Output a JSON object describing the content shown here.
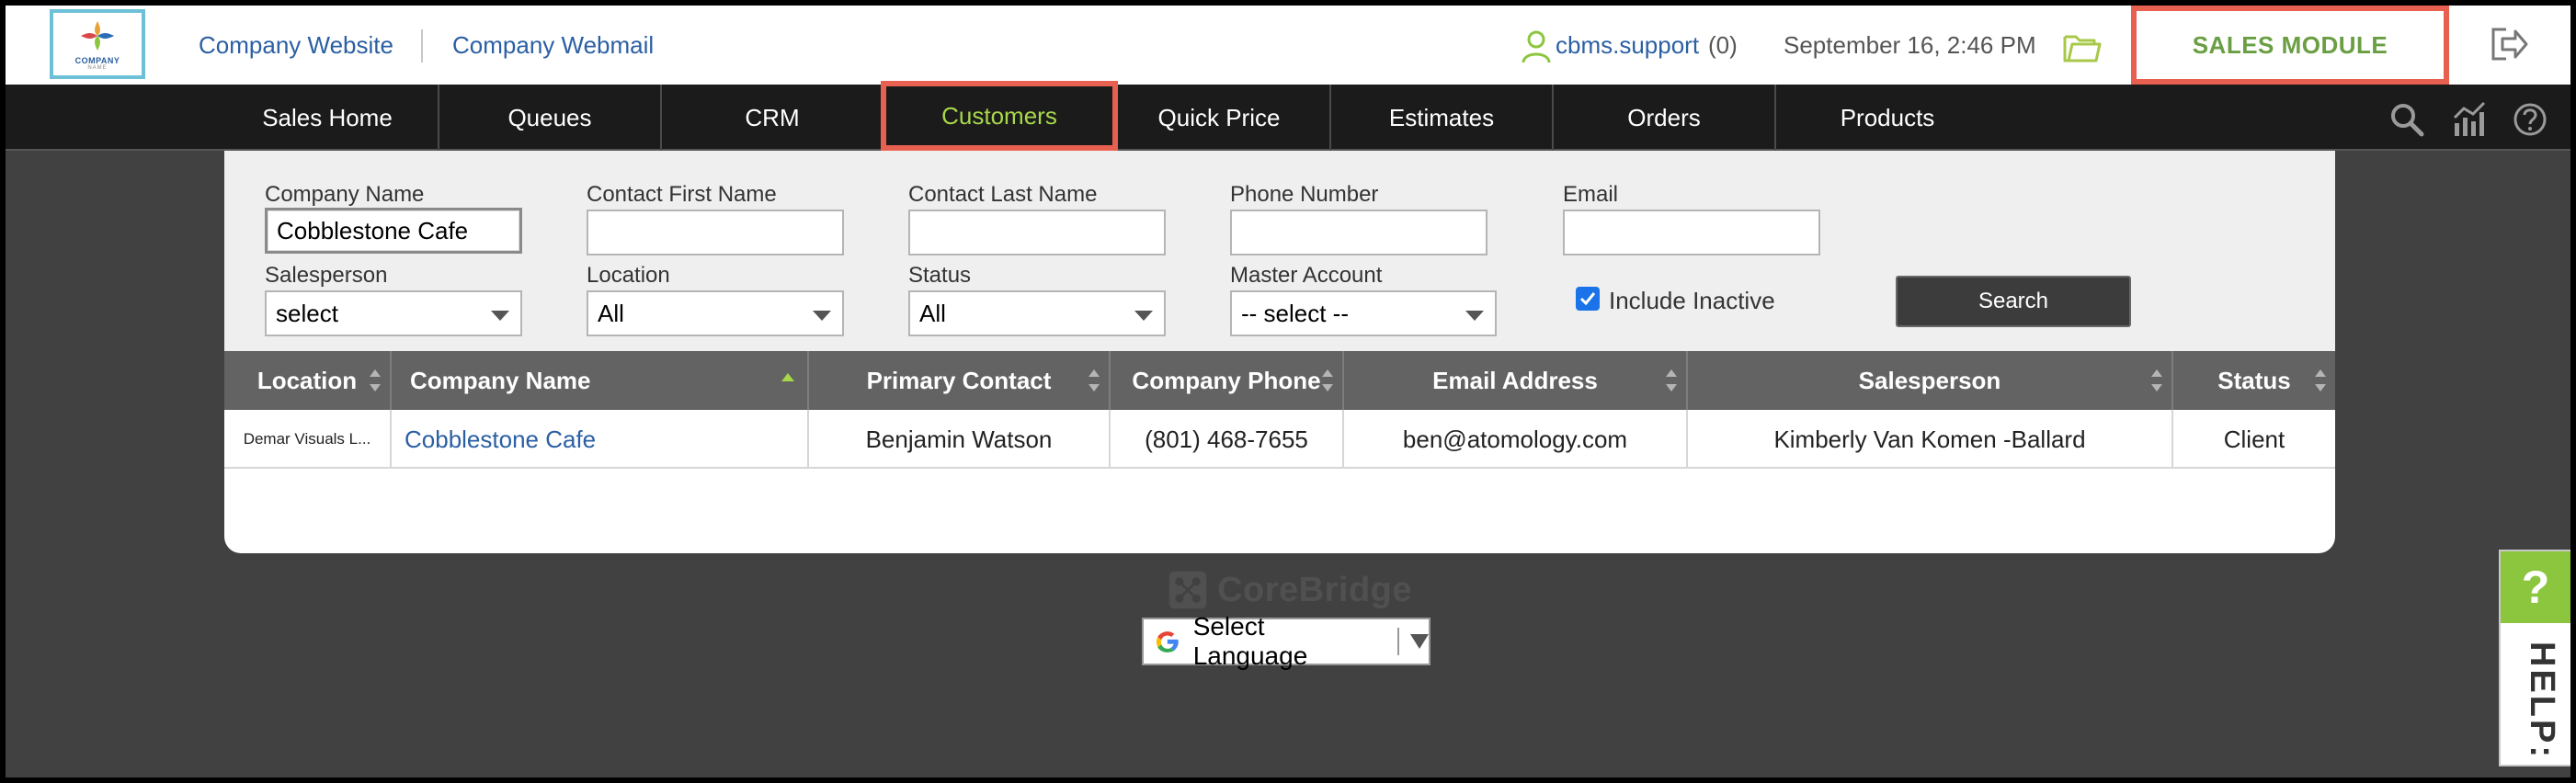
{
  "header": {
    "logo_text": "COMPANY",
    "logo_subtext": "NAME",
    "link_website": "Company Website",
    "link_webmail": "Company Webmail",
    "user_name": "cbms.support",
    "user_count": "(0)",
    "datetime": "September 16, 2:46 PM",
    "module_label": "SALES MODULE",
    "icons": [
      "user-icon",
      "folder-icon",
      "logout-icon"
    ]
  },
  "nav": {
    "items": [
      {
        "label": "Sales Home"
      },
      {
        "label": "Queues"
      },
      {
        "label": "CRM"
      },
      {
        "label": "Customers",
        "active": true
      },
      {
        "label": "Quick Price"
      },
      {
        "label": "Estimates"
      },
      {
        "label": "Orders"
      },
      {
        "label": "Products"
      }
    ],
    "icons": [
      "search-icon",
      "analytics-icon",
      "help-circle-icon"
    ]
  },
  "filters": {
    "company_name_label": "Company Name",
    "company_name_value": "Cobblestone Cafe",
    "contact_first_label": "Contact First Name",
    "contact_first_value": "",
    "contact_last_label": "Contact Last Name",
    "contact_last_value": "",
    "phone_label": "Phone Number",
    "phone_value": "",
    "email_label": "Email",
    "email_value": "",
    "salesperson_label": "Salesperson",
    "salesperson_value": "select",
    "location_label": "Location",
    "location_value": "All",
    "status_label": "Status",
    "status_value": "All",
    "master_account_label": "Master Account",
    "master_account_value": "-- select --",
    "include_inactive_label": "Include Inactive",
    "include_inactive_checked": true,
    "search_button": "Search"
  },
  "table": {
    "columns": [
      "Location",
      "Company Name",
      "Primary Contact",
      "Company Phone",
      "Email Address",
      "Salesperson",
      "Status"
    ],
    "rows": [
      {
        "location": "Demar Visuals L...",
        "company_name": "Cobblestone Cafe",
        "primary_contact": "Benjamin Watson",
        "company_phone": "(801) 468-7655",
        "email": "ben@atomology.com",
        "salesperson": "Kimberly Van Komen -Ballard",
        "status": "Client"
      }
    ],
    "sorted_column": "Company Name",
    "sort_direction": "ascending"
  },
  "footer": {
    "brand": "CoreBridge",
    "language_label": "Select Language"
  },
  "help_tab": {
    "symbol": "?",
    "label": "HELP:"
  },
  "colors": {
    "accent_green": "#a8d84a",
    "module_green": "#6a9e43",
    "link_blue": "#2b5fa3",
    "highlight_red": "#e8604f",
    "nav_bg": "#1b1b1b",
    "page_bg": "#414141"
  }
}
